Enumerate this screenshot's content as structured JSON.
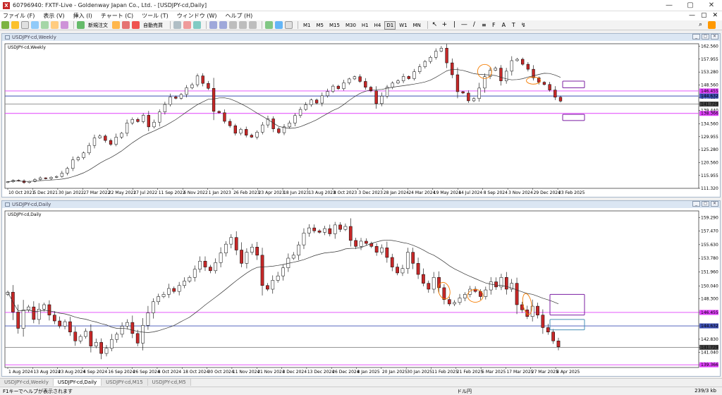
{
  "titlebar": {
    "app_icon": "X",
    "title": "60796940: FXTF-Live - Goldenway Japan Co., Ltd. - [USDJPY-cd,Daily]",
    "minimize": "—",
    "maximize": "▢",
    "close": "✕"
  },
  "menu": {
    "items": [
      "ファイル (F)",
      "表示 (V)",
      "挿入 (I)",
      "チャート (C)",
      "ツール (T)",
      "ウィンドウ (W)",
      "ヘルプ (H)"
    ],
    "right": [
      "—",
      "▢",
      "✕"
    ]
  },
  "toolbar": {
    "new_order": "新規注文",
    "auto_trade": "自動売買",
    "timeframes": [
      "M1",
      "M5",
      "M15",
      "M30",
      "H1",
      "H4",
      "D1",
      "W1",
      "MN"
    ],
    "active_timeframe": "D1"
  },
  "weekly": {
    "title": "USDJPY-cd,Weekly",
    "label": "USDJPY-cd,Weekly",
    "header_buttons": [
      "_",
      "▢",
      "✕"
    ],
    "price_labels": [
      "162.560",
      "157.955",
      "153.280",
      "148.560",
      "144.120",
      "141.729",
      "139.440",
      "134.560",
      "129.955",
      "125.280",
      "120.560",
      "115.955",
      "111.320"
    ],
    "price_values": [
      162.56,
      157.955,
      153.28,
      148.56,
      144.12,
      141.729,
      139.44,
      134.56,
      129.955,
      125.28,
      120.56,
      115.955,
      111.32
    ],
    "highlight_labels": [
      {
        "text": "146.455",
        "value": 146.455,
        "color": "#e040fb"
      },
      {
        "text": "144.632",
        "value": 144.632,
        "color": "#3f51b5"
      },
      {
        "text": "141.729",
        "value": 141.729,
        "color": "#444444"
      },
      {
        "text": "138.366",
        "value": 138.366,
        "color": "#e040fb"
      }
    ],
    "date_labels": [
      "10 Oct 2021",
      "5 Dec 2021",
      "30 Jan 2022",
      "27 Mar 2022",
      "22 May 2022",
      "17 Jul 2022",
      "11 Sep 2022",
      "6 Nov 2022",
      "1 Jan 2023",
      "26 Feb 2023",
      "23 Apr 2023",
      "18 Jun 2023",
      "13 Aug 2023",
      "8 Oct 2023",
      "3 Dec 2023",
      "28 Jan 2024",
      "24 Mar 2024",
      "19 May 2024",
      "14 Jul 2024",
      "8 Sep 2024",
      "3 Nov 2024",
      "29 Dec 2024",
      "23 Feb 2025"
    ],
    "hlines": [
      {
        "value": 146.455,
        "color": "#e040fb"
      },
      {
        "value": 144.632,
        "color": "#3f51b5"
      },
      {
        "value": 141.729,
        "color": "#888888"
      },
      {
        "value": 138.366,
        "color": "#e040fb"
      }
    ]
  },
  "daily": {
    "title": "USDJPY-cd,Daily",
    "label": "USDJPY-cd,Daily",
    "header_buttons": [
      "_",
      "▢",
      "✕"
    ],
    "price_labels": [
      "159.290",
      "157.470",
      "155.630",
      "153.780",
      "151.960",
      "150.040",
      "148.300",
      "146.455",
      "144.632",
      "142.830",
      "141.729",
      "141.040",
      "139.366"
    ],
    "price_values": [
      159.29,
      157.47,
      155.63,
      153.78,
      151.96,
      150.04,
      148.3,
      146.455,
      144.632,
      142.83,
      141.729,
      141.04,
      139.366
    ],
    "highlight_labels": [
      {
        "text": "146.455",
        "value": 146.455,
        "color": "#e040fb"
      },
      {
        "text": "144.632",
        "value": 144.632,
        "color": "#3f51b5"
      },
      {
        "text": "141.729",
        "value": 141.729,
        "color": "#444444"
      },
      {
        "text": "139.366",
        "value": 139.366,
        "color": "#e040fb"
      }
    ],
    "date_labels": [
      "1 Aug 2024",
      "13 Aug 2024",
      "23 Aug 2024",
      "4 Sep 2024",
      "16 Sep 2024",
      "26 Sep 2024",
      "8 Oct 2024",
      "18 Oct 2024",
      "30 Oct 2024",
      "11 Nov 2024",
      "21 Nov 2024",
      "3 Dec 2024",
      "13 Dec 2024",
      "26 Dec 2024",
      "8 Jan 2025",
      "20 Jan 2025",
      "30 Jan 2025",
      "11 Feb 2025",
      "21 Feb 2025",
      "5 Mar 2025",
      "17 Mar 2025",
      "27 Mar 2025",
      "8 Apr 2025"
    ],
    "hlines": [
      {
        "value": 146.455,
        "color": "#e040fb"
      },
      {
        "value": 144.632,
        "color": "#3f51b5"
      },
      {
        "value": 141.729,
        "color": "#888888"
      },
      {
        "value": 139.366,
        "color": "#e040fb"
      }
    ]
  },
  "chart_data": [
    {
      "type": "candlestick",
      "title": "USDJPY-cd,Weekly",
      "ylim": [
        111.32,
        163.5
      ],
      "x_range": [
        "10 Oct 2021",
        "Apr 2025"
      ],
      "closes": [
        113.7,
        114.2,
        114.0,
        113.4,
        113.8,
        114.5,
        115.1,
        114.8,
        115.3,
        115.6,
        116.8,
        118.5,
        121.6,
        122.4,
        124.1,
        126.8,
        129.5,
        130.2,
        128.6,
        127.2,
        129.8,
        131.2,
        134.9,
        136.2,
        135.4,
        137.7,
        133.5,
        135.2,
        138.9,
        141.6,
        144.3,
        143.8,
        145.2,
        147.6,
        148.7,
        151.9,
        149.2,
        147.4,
        139.1,
        138.6,
        135.5,
        133.9,
        131.2,
        132.6,
        130.5,
        129.8,
        131.6,
        134.2,
        136.4,
        132.8,
        131.4,
        133.5,
        134.9,
        137.6,
        139.8,
        141.5,
        143.2,
        142.1,
        144.7,
        146.3,
        148.2,
        147.3,
        149.4,
        150.8,
        151.6,
        149.9,
        147.8,
        146.5,
        141.9,
        144.6,
        147.8,
        149.3,
        150.1,
        151.7,
        150.9,
        153.4,
        155.2,
        157.1,
        158.6,
        160.8,
        161.9,
        156.6,
        152.3,
        146.2,
        145.7,
        142.9,
        143.7,
        147.5,
        151.6,
        153.9,
        154.7,
        150.1,
        153.6,
        157.4,
        157.9,
        156.1,
        154.3,
        151.2,
        149.6,
        148.8,
        146.8,
        144.2,
        142.8
      ]
    },
    {
      "type": "candlestick",
      "title": "USDJPY-cd,Daily",
      "ylim": [
        139.0,
        160.2
      ],
      "x_range": [
        "1 Aug 2024",
        "14 Apr 2025"
      ],
      "closes": [
        149.2,
        146.5,
        144.3,
        146.8,
        147.2,
        145.5,
        146.9,
        147.5,
        146.1,
        145.3,
        144.6,
        145.2,
        143.8,
        142.6,
        143.2,
        143.9,
        141.9,
        142.4,
        140.9,
        141.6,
        142.8,
        143.5,
        144.6,
        145.1,
        143.6,
        142.3,
        144.7,
        146.4,
        147.9,
        148.6,
        148.9,
        149.7,
        149.3,
        150.1,
        150.7,
        151.2,
        152.3,
        153.4,
        152.6,
        152.1,
        153.2,
        154.5,
        155.7,
        156.6,
        154.9,
        153.1,
        154.6,
        155.3,
        154.2,
        150.1,
        149.6,
        150.8,
        151.4,
        152.5,
        153.8,
        154.2,
        155.6,
        157.2,
        157.9,
        157.5,
        157.3,
        157.8,
        157.1,
        158.3,
        157.7,
        158.1,
        156.2,
        155.4,
        156.1,
        155.8,
        155.4,
        154.6,
        155.2,
        153.9,
        152.6,
        151.8,
        152.4,
        154.6,
        153.1,
        151.6,
        150.4,
        149.6,
        151.2,
        149.8,
        148.2,
        147.6,
        147.8,
        148.4,
        148.9,
        149.6,
        149.3,
        148.6,
        149.5,
        150.6,
        149.9,
        151.2,
        149.6,
        150.4,
        147.5,
        146.8,
        145.9,
        147.3,
        146.1,
        144.4,
        143.8,
        142.6,
        141.8
      ]
    }
  ],
  "tabs": [
    "USDJPY-cd,Weekly",
    "USDJPY-cd,Daily",
    "USDJPY-cd,M15",
    "USDJPY-cd,M5"
  ],
  "active_tab": 1,
  "status": {
    "help": "F1キーでヘルプが表示されます",
    "mid": "ドル円",
    "right": "239/3 kb"
  },
  "colors": {
    "bull": "#ffffff",
    "bear": "#c62828",
    "ma": "#333333",
    "annotation": "#f57c00",
    "box_purple": "#7b1fa2",
    "box_blue": "#4a90b8",
    "grid": "#f2f2f2"
  }
}
